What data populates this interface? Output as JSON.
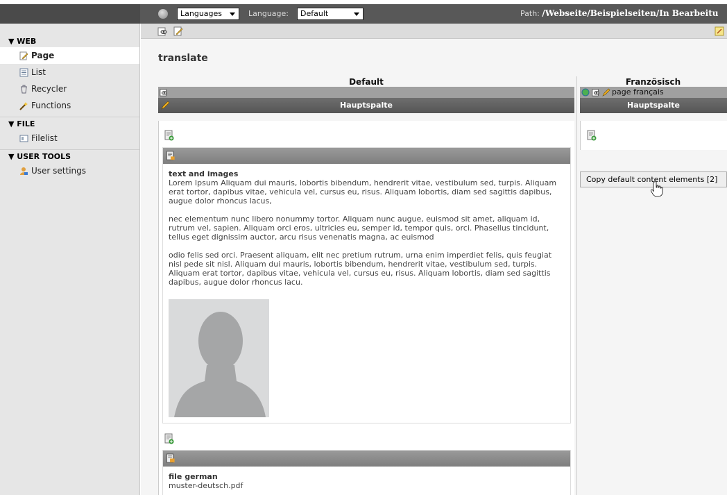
{
  "topbar": {
    "module_select": "Languages",
    "language_label": "Language:",
    "language_select": "Default",
    "path_label": "Path:",
    "path_value": "/Webseite/Beispielseiten/In Bearbeitu"
  },
  "sidebar": {
    "sections": [
      {
        "label": "▼ WEB",
        "items": [
          {
            "label": "Page",
            "icon": "page-edit-icon",
            "active": true
          },
          {
            "label": "List",
            "icon": "list-icon"
          },
          {
            "label": "Recycler",
            "icon": "recycler-icon"
          },
          {
            "label": "Functions",
            "icon": "functions-wand-icon"
          }
        ]
      },
      {
        "label": "▼ FILE",
        "items": [
          {
            "label": "Filelist",
            "icon": "filelist-icon"
          }
        ]
      },
      {
        "label": "▼ USER TOOLS",
        "items": [
          {
            "label": "User settings",
            "icon": "user-settings-icon"
          }
        ]
      }
    ]
  },
  "main": {
    "title": "translate",
    "default_column": {
      "header": "Default",
      "section": "Hauptspalte",
      "elements": [
        {
          "heading": "text and images",
          "paragraphs": [
            "Lorem Ipsum Aliquam dui mauris, lobortis bibendum, hendrerit vitae, vestibulum sed, turpis. Aliquam erat tortor, dapibus vitae, vehicula vel, cursus eu, risus. Aliquam lobortis, diam sed sagittis dapibus, augue dolor rhoncus lacus,",
            "nec elementum nunc libero nonummy tortor. Aliquam nunc augue, euismod sit amet, aliquam id, rutrum vel, sapien. Aliquam orci eros, ultricies eu, semper id, tempor quis, orci. Phasellus tincidunt, tellus eget dignissim auctor, arcu risus venenatis magna, ac euismod",
            "odio felis sed orci. Praesent aliquam, elit nec pretium rutrum, urna enim imperdiet felis, quis feugiat nisl pede sit nisl. Aliquam dui mauris, lobortis bibendum, hendrerit vitae, vestibulum sed, turpis. Aliquam erat tortor, dapibus vitae, vehicula vel, cursus eu, risus. Aliquam lobortis, diam sed sagittis dapibus, augue dolor rhoncus lacu."
          ]
        },
        {
          "heading": "file german",
          "file": "muster-deutsch.pdf"
        }
      ]
    },
    "french_column": {
      "header": "Französisch",
      "page_title": "page français",
      "section": "Hauptspalte",
      "copy_button": "Copy default content elements [2]"
    }
  }
}
